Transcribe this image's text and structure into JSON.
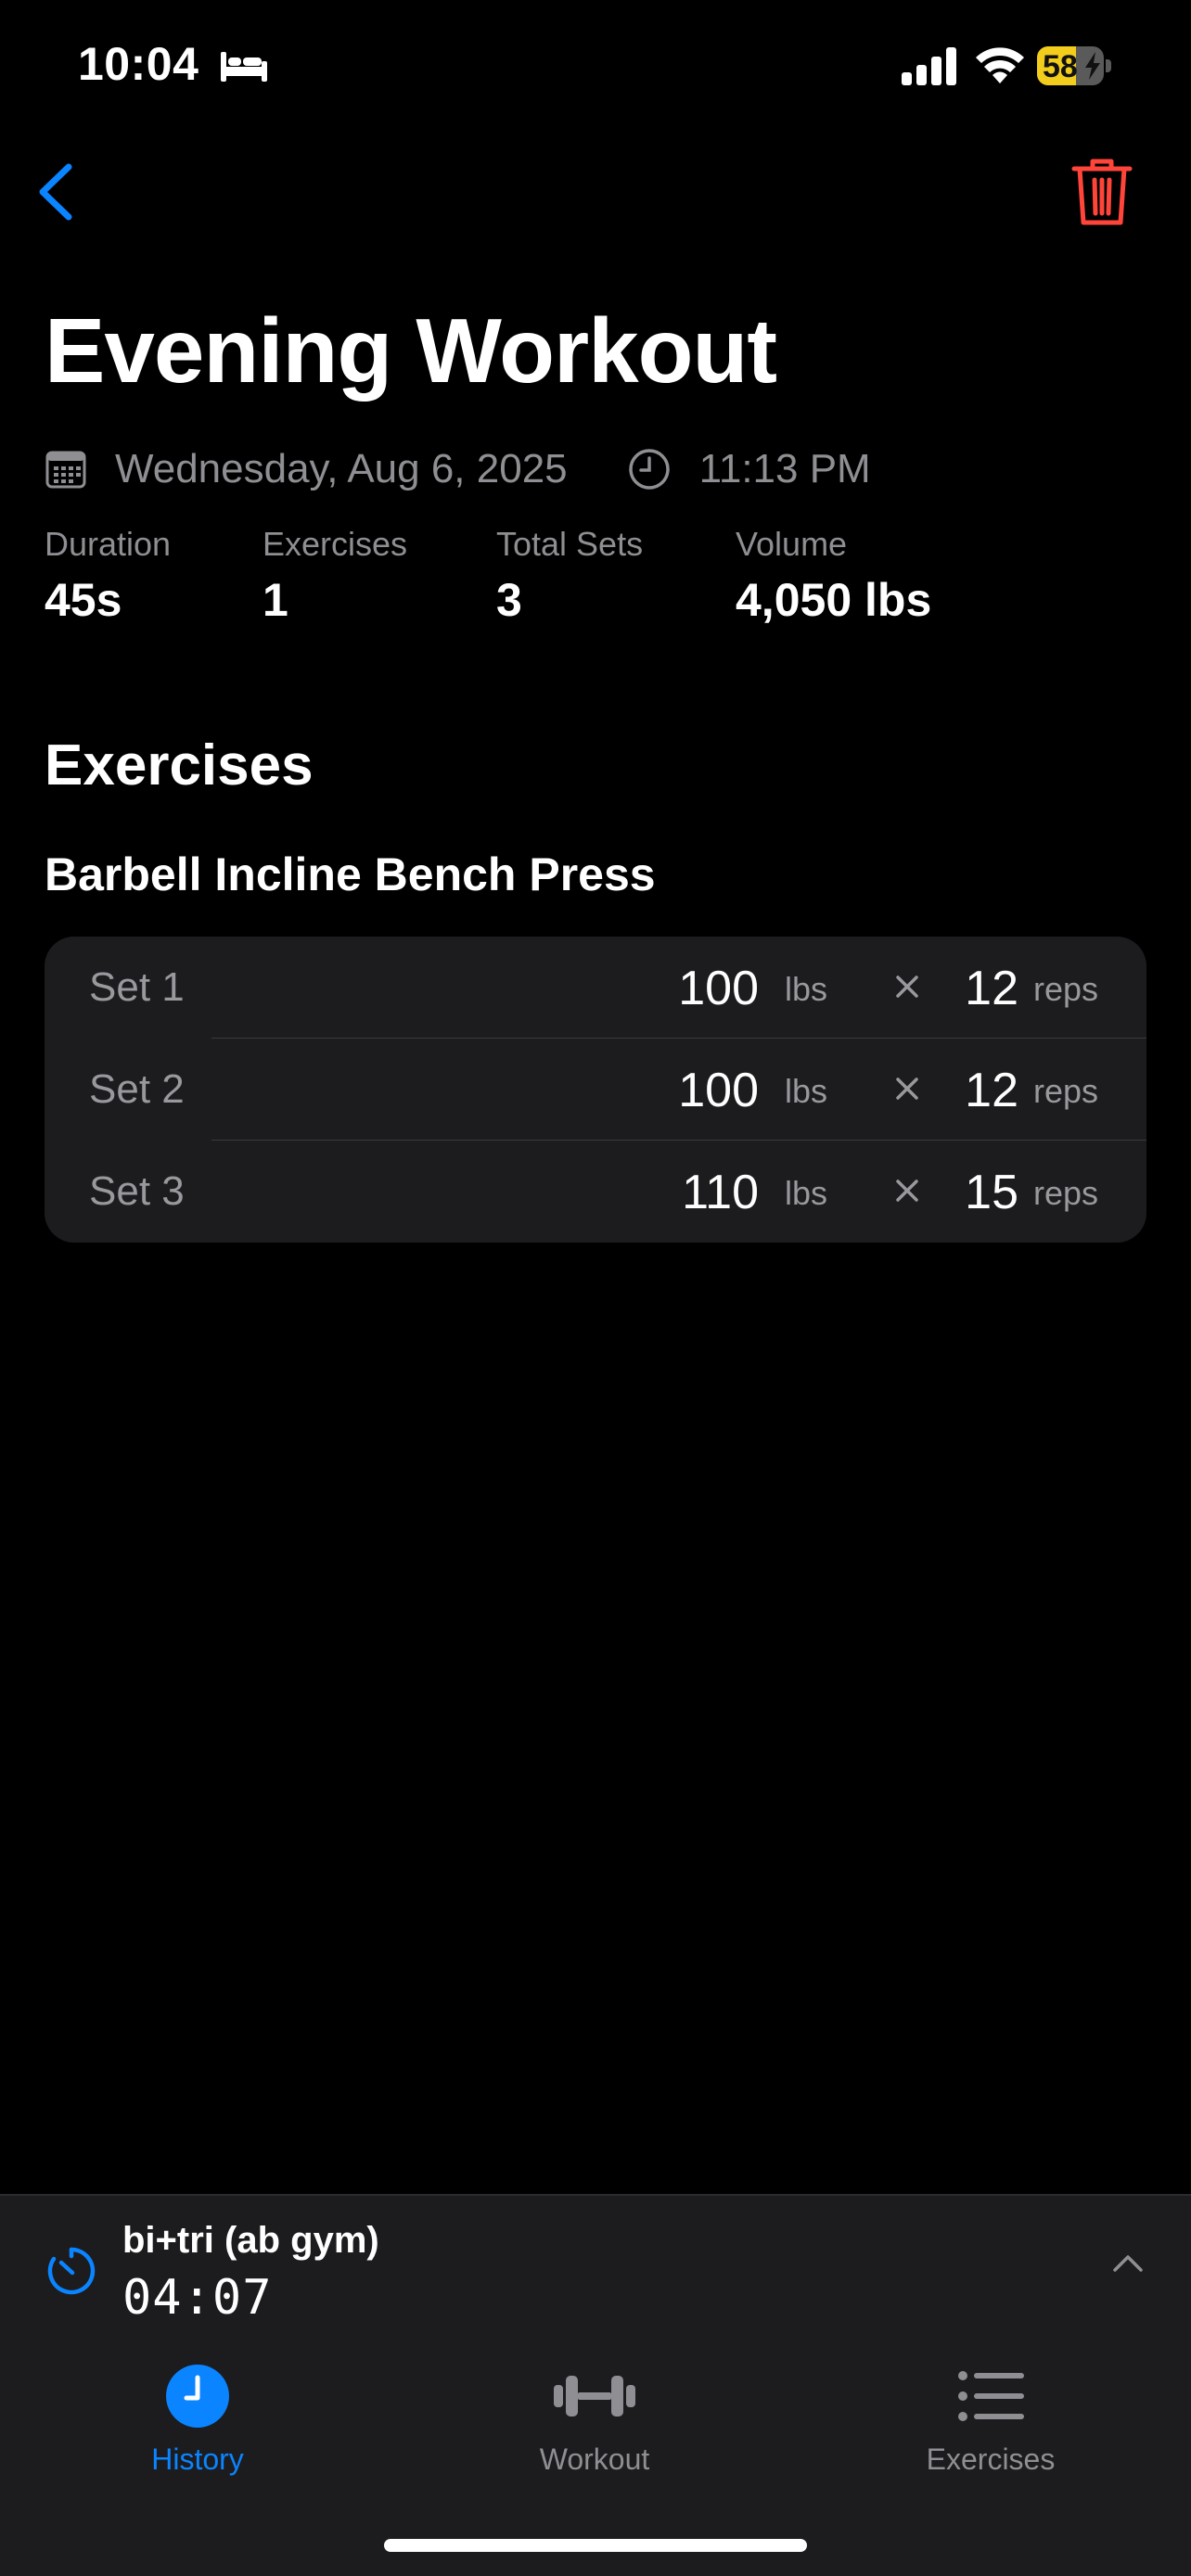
{
  "status_bar": {
    "time": "10:04",
    "battery": "58",
    "battery_level": 0.58
  },
  "header": {
    "title": "Evening Workout",
    "date": "Wednesday, Aug 6, 2025",
    "time": "11:13 PM"
  },
  "stats": [
    {
      "label": "Duration",
      "value": "45s"
    },
    {
      "label": "Exercises",
      "value": "1"
    },
    {
      "label": "Total Sets",
      "value": "3"
    },
    {
      "label": "Volume",
      "value": "4,050 lbs"
    }
  ],
  "exercises_section": {
    "title": "Exercises",
    "exercise_name": "Barbell Incline Bench Press",
    "sets": [
      {
        "label": "Set 1",
        "weight": "100",
        "weight_unit": "lbs",
        "times": "×",
        "reps": "12",
        "reps_unit": "reps"
      },
      {
        "label": "Set 2",
        "weight": "100",
        "weight_unit": "lbs",
        "times": "×",
        "reps": "12",
        "reps_unit": "reps"
      },
      {
        "label": "Set 3",
        "weight": "110",
        "weight_unit": "lbs",
        "times": "×",
        "reps": "15",
        "reps_unit": "reps"
      }
    ]
  },
  "active_workout": {
    "name": "bi+tri (ab gym)",
    "elapsed": "04:07"
  },
  "tabs": [
    {
      "label": "History",
      "active": true
    },
    {
      "label": "Workout",
      "active": false
    },
    {
      "label": "Exercises",
      "active": false
    }
  ],
  "colors": {
    "accent": "#0a84ff",
    "destructive": "#ff453a",
    "battery": "#f2cd1c",
    "background": "#000000",
    "card": "#1c1c1e"
  },
  "icons": [
    "bed-icon",
    "signal-icon",
    "wifi-icon",
    "battery-icon",
    "back-chevron-icon",
    "trash-icon",
    "calendar-icon",
    "clock-icon",
    "timer-icon",
    "chevron-up-icon",
    "history-clock-icon",
    "dumbbell-icon",
    "list-icon"
  ]
}
